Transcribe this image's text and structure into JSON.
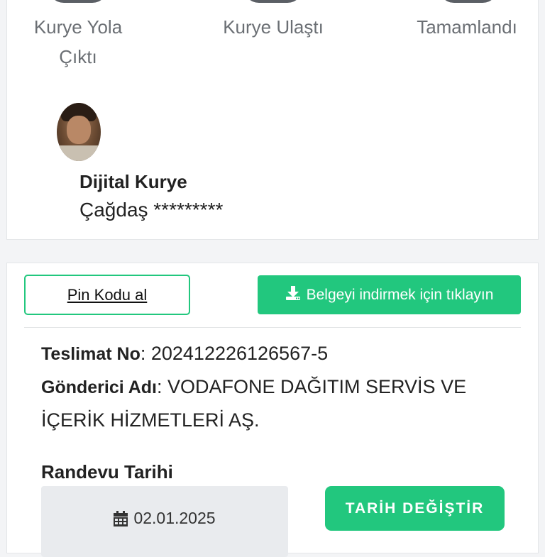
{
  "tracking_steps": [
    {
      "label_line1": "Kurye Yola",
      "label_line2": "Çıktı"
    },
    {
      "label_line1": "Kurye Ulaştı"
    },
    {
      "label_line1": "Tamamlandı"
    }
  ],
  "courier": {
    "title": "Dijital Kurye",
    "name": "Çağdaş *********"
  },
  "actions": {
    "pin_label": "Pin Kodu al",
    "download_label": "Belgeyi indirmek için tıklayın",
    "download_icon": "download-icon"
  },
  "shipment": {
    "tracking_label": "Teslimat No",
    "tracking_value": "202412226126567-5",
    "sender_label": "Gönderici Adı",
    "sender_value_line1": "VODAFONE DAĞITIM SERVİS VE",
    "sender_value_line2": "İÇERİK HİZMETLERİ AŞ."
  },
  "appointment": {
    "label": "Randevu Tarihi",
    "date": "02.01.2025",
    "calendar_icon": "calendar-icon",
    "change_label": "TARİH DEĞİŞTİR"
  },
  "colors": {
    "accent": "#22c77e",
    "step_icon": "#5b5f65"
  }
}
